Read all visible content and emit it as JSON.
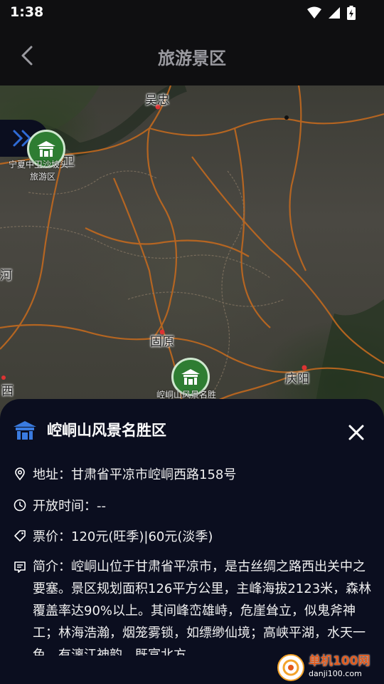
{
  "status_bar": {
    "time": "1:38"
  },
  "header": {
    "title": "旅游景区"
  },
  "map": {
    "labels": {
      "wuzhong": "吴忠",
      "guyuan": "固原",
      "qingyang": "庆阳",
      "he": "河",
      "xi": "西",
      "zhongwei_park": "宁夏中卫沙坡头",
      "zhongwei_sub": "旅游区",
      "wei": "卫",
      "kongtong_marker": "崆峒山风景名胜"
    }
  },
  "sheet": {
    "title": "崆峒山风景名胜区",
    "address": "地址：甘肃省平凉市崆峒西路158号",
    "hours": "开放时间：--",
    "price": "票价：120元(旺季)|60元(淡季)",
    "intro": "简介：崆峒山位于甘肃省平凉市，是古丝绸之路西出关中之要塞。景区规划面积126平方公里，主峰海拔2123米，森林覆盖率达90%以上。其间峰峦雄峙，危崖耸立，似鬼斧神工；林海浩瀚，烟笼雾锁，如缥缈仙境；高峡平湖，水天一色，有漓江神韵。既富北方"
  },
  "watermark": {
    "title": "单机100网",
    "url": "danji100.com"
  },
  "colors": {
    "marker_green": "#2e7d32",
    "sheet_bg": "#0b0e1f",
    "accent_blue": "#2f6bd6"
  }
}
